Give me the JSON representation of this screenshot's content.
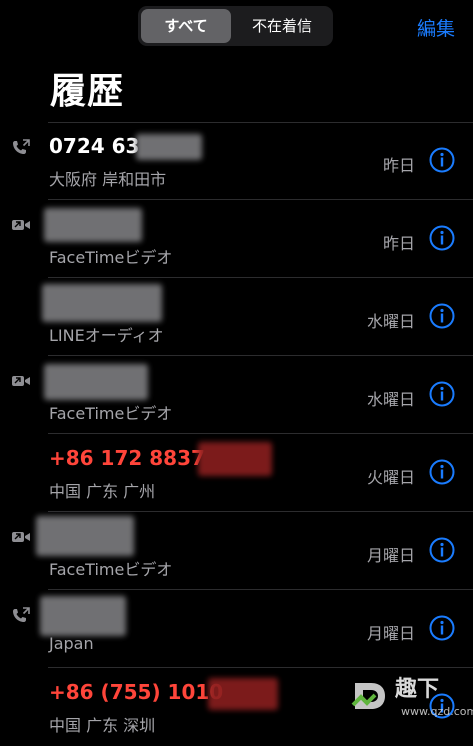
{
  "header": {
    "tabs": [
      {
        "label": "すべて",
        "selected": true
      },
      {
        "label": "不在着信",
        "selected": false
      }
    ],
    "edit_label": "編集",
    "title": "履歴"
  },
  "calls": [
    {
      "name": "0724 63",
      "subtitle": "大阪府 岸和田市",
      "date": "昨日",
      "icon": "phone-outgoing-icon",
      "missed": false
    },
    {
      "name": "",
      "subtitle": "FaceTimeビデオ",
      "date": "昨日",
      "icon": "video-camera-icon",
      "missed": false
    },
    {
      "name": "",
      "subtitle": "LINEオーディオ",
      "date": "水曜日",
      "icon": "",
      "missed": false
    },
    {
      "name": "",
      "subtitle": "FaceTimeビデオ",
      "date": "水曜日",
      "icon": "video-camera-icon",
      "missed": false
    },
    {
      "name": "+86 172 8837",
      "subtitle": "中国 广东 广州",
      "date": "火曜日",
      "icon": "",
      "missed": true
    },
    {
      "name": "",
      "subtitle": "FaceTimeビデオ",
      "date": "月曜日",
      "icon": "video-camera-icon",
      "missed": false
    },
    {
      "name": "",
      "subtitle": "Japan",
      "date": "月曜日",
      "icon": "phone-outgoing-icon",
      "missed": false
    },
    {
      "name": "+86 (755) 1010",
      "subtitle": "中国 广东 深圳",
      "date": "",
      "icon": "",
      "missed": true
    }
  ],
  "watermark": {
    "text": "趣下",
    "url": "www.qzd.com"
  },
  "colors": {
    "accent": "#1a7cff",
    "missed": "#ff453a",
    "secondary": "#a5a5aa"
  }
}
